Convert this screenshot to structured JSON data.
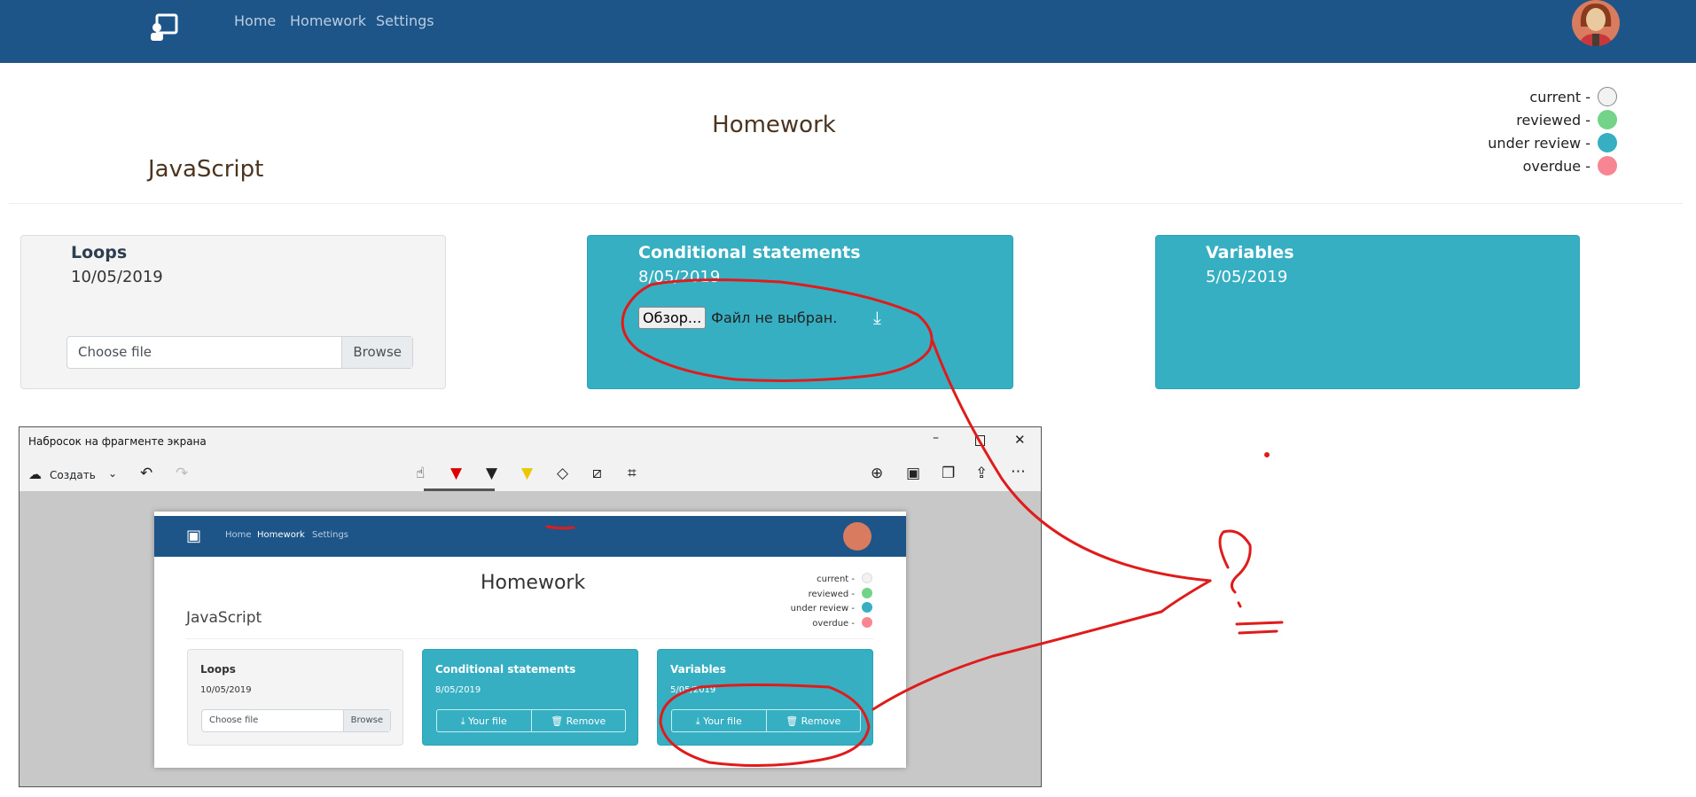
{
  "nav": {
    "links": [
      "Home",
      "Homework",
      "Settings"
    ]
  },
  "page": {
    "title": "Homework",
    "course": "JavaScript"
  },
  "legend": [
    {
      "label": "current -",
      "color": "#f2f2f2"
    },
    {
      "label": "reviewed -",
      "color": "#72d389"
    },
    {
      "label": "under review -",
      "color": "#37afc2"
    },
    {
      "label": "overdue -",
      "color": "#f78592"
    }
  ],
  "cards": [
    {
      "title": "Loops",
      "date": "10/05/2019",
      "file_placeholder": "Choose file",
      "browse": "Browse"
    },
    {
      "title": "Conditional statements",
      "date": "8/05/2019",
      "browse_native": "Обзор...",
      "no_file": "Файл не выбран."
    },
    {
      "title": "Variables",
      "date": "5/05/2019"
    }
  ],
  "snip": {
    "window_title": "Набросок на фрагменте экрана",
    "create": "Создать",
    "inner": {
      "links": [
        "Home",
        "Homework",
        "Settings"
      ],
      "title": "Homework",
      "course": "JavaScript",
      "legend": [
        "current -",
        "reviewed -",
        "under review -",
        "overdue -"
      ],
      "cards": [
        {
          "title": "Loops",
          "date": "10/05/2019",
          "file_placeholder": "Choose file",
          "browse": "Browse"
        },
        {
          "title": "Conditional statements",
          "date": "8/05/2019",
          "your_file": "Your file",
          "remove": "Remove"
        },
        {
          "title": "Variables",
          "date": "5/05/2019",
          "your_file": "Your file",
          "remove": "Remove"
        }
      ]
    }
  },
  "annotation": {
    "mark": "?="
  }
}
